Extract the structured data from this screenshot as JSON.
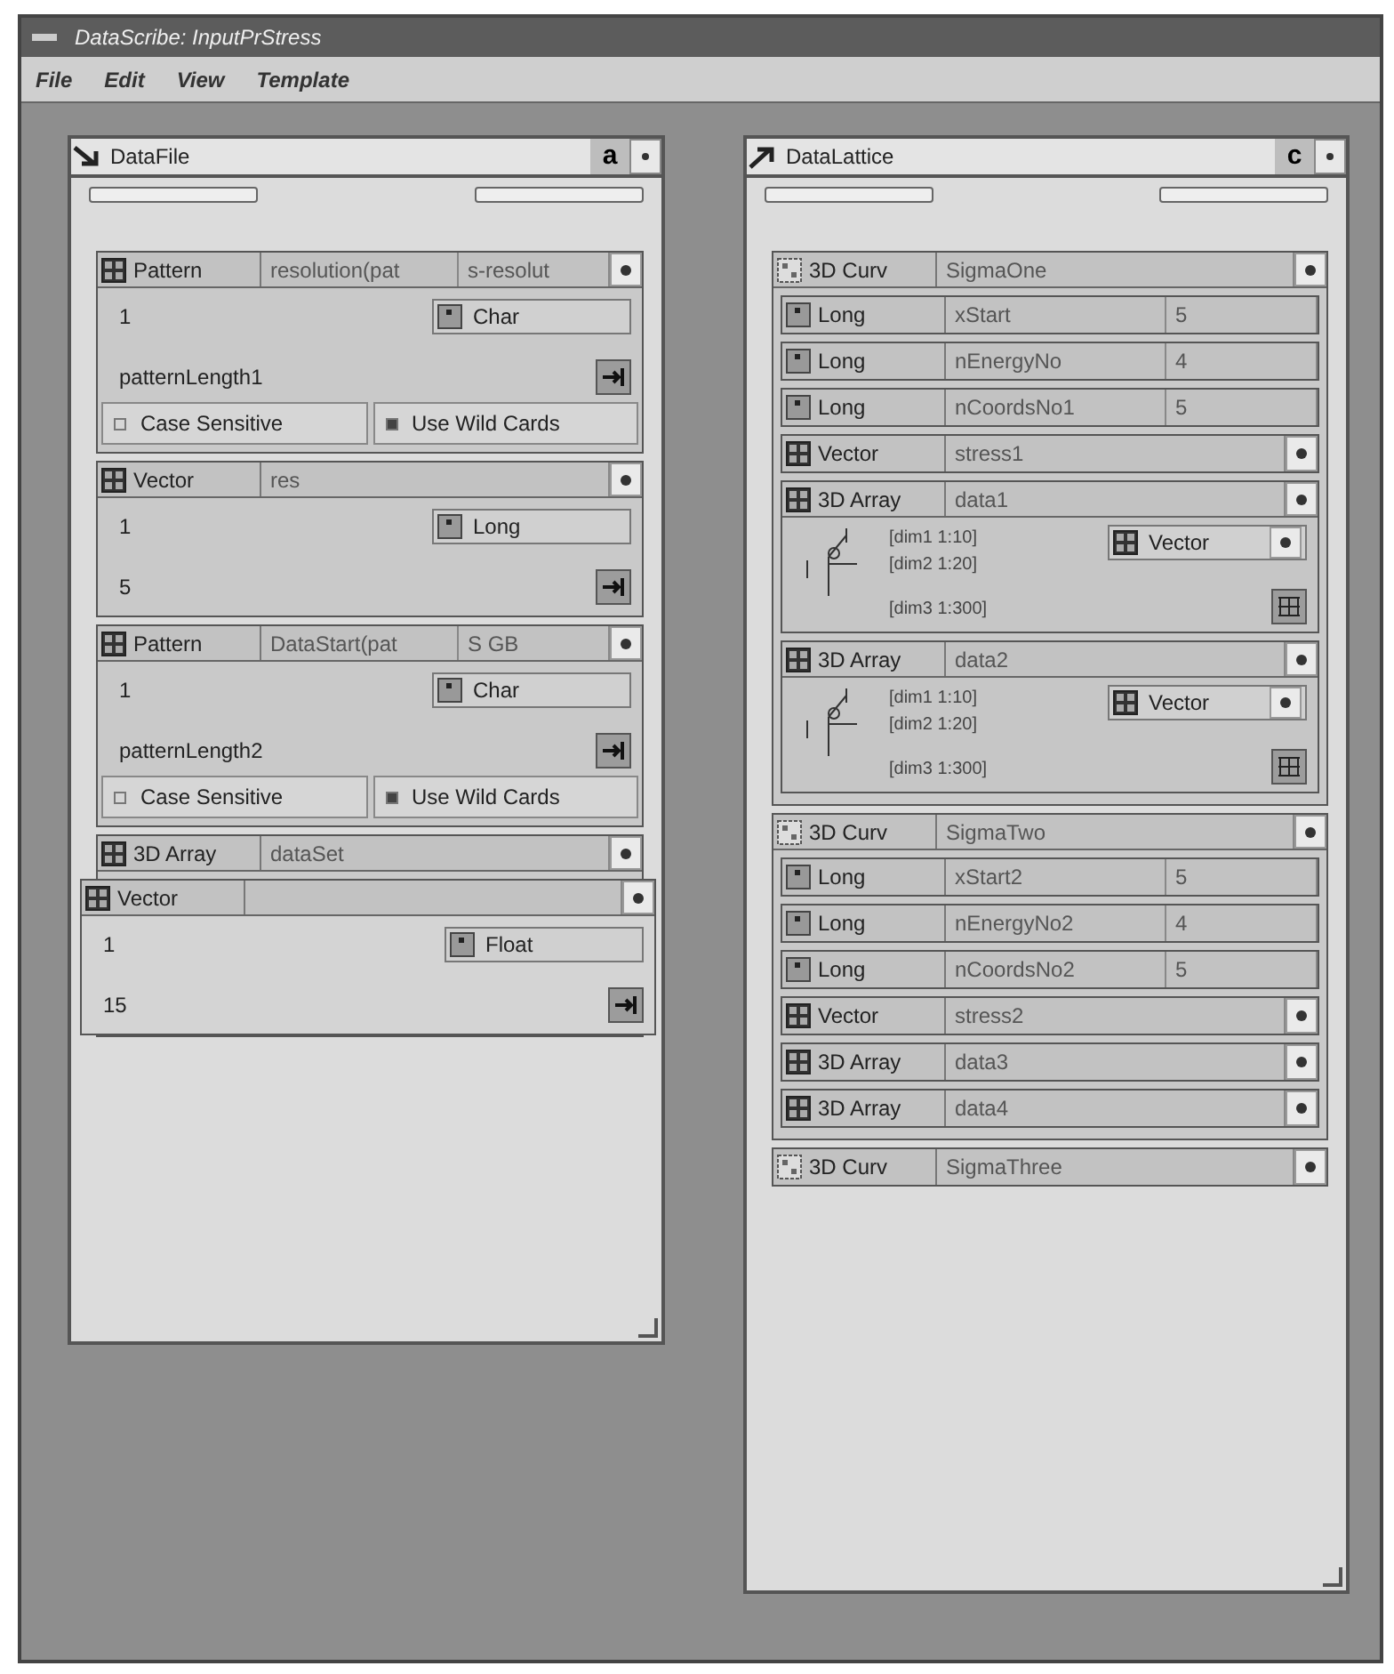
{
  "window": {
    "title": "DataScribe: InputPrStress"
  },
  "menu": [
    "File",
    "Edit",
    "View",
    "Template"
  ],
  "panels": [
    {
      "title": "DataFile",
      "mode": "a",
      "items": [
        {
          "kind": "pattern",
          "type": "Pattern",
          "name": "resolution(pat",
          "value": "s-resolut",
          "index": "1",
          "element_type": "Char",
          "length": "patternLength1",
          "options": [
            {
              "label": "Case Sensitive",
              "checked": false
            },
            {
              "label": "Use Wild Cards",
              "checked": true
            }
          ]
        },
        {
          "kind": "vector",
          "type": "Vector",
          "name": "res",
          "index": "1",
          "element_type": "Long",
          "length": "5"
        },
        {
          "kind": "pattern",
          "type": "Pattern",
          "name": "DataStart(pat",
          "value": "S GB",
          "index": "1",
          "element_type": "Char",
          "length": "patternLength2",
          "options": [
            {
              "label": "Case Sensitive",
              "checked": false
            },
            {
              "label": "Use Wild Cards",
              "checked": true
            }
          ]
        },
        {
          "kind": "array",
          "type": "3D Array",
          "name": "dataSet",
          "children": [
            {
              "kind": "vector",
              "type": "Vector",
              "index": "1",
              "element_type": "Float",
              "length": "15"
            }
          ]
        }
      ]
    },
    {
      "title": "DataLattice",
      "mode": "c",
      "items": [
        {
          "kind": "curve",
          "type": "3D Curv",
          "name": "SigmaOne",
          "expanded": true,
          "children": [
            {
              "kind": "scalar",
              "type": "Long",
              "name": "xStart",
              "value": "5"
            },
            {
              "kind": "scalar",
              "type": "Long",
              "name": "nEnergyNo",
              "value": "4"
            },
            {
              "kind": "scalar",
              "type": "Long",
              "name": "nCoordsNo1",
              "value": "5"
            },
            {
              "kind": "ref",
              "type": "Vector",
              "name": "stress1"
            },
            {
              "kind": "tree",
              "type": "3D Array",
              "name": "data1",
              "element_type": "Vector",
              "dims": [
                "[dim1 1:10]",
                "[dim2 1:20]",
                "[dim3 1:300]"
              ]
            },
            {
              "kind": "tree",
              "type": "3D Array",
              "name": "data2",
              "element_type": "Vector",
              "dims": [
                "[dim1 1:10]",
                "[dim2 1:20]",
                "[dim3 1:300]"
              ]
            }
          ]
        },
        {
          "kind": "curve",
          "type": "3D Curv",
          "name": "SigmaTwo",
          "expanded": true,
          "children": [
            {
              "kind": "scalar",
              "type": "Long",
              "name": "xStart2",
              "value": "5"
            },
            {
              "kind": "scalar",
              "type": "Long",
              "name": "nEnergyNo2",
              "value": "4"
            },
            {
              "kind": "scalar",
              "type": "Long",
              "name": "nCoordsNo2",
              "value": "5"
            },
            {
              "kind": "ref",
              "type": "Vector",
              "name": "stress2"
            },
            {
              "kind": "ref",
              "type": "3D Array",
              "name": "data3"
            },
            {
              "kind": "ref",
              "type": "3D Array",
              "name": "data4"
            }
          ]
        },
        {
          "kind": "curve",
          "type": "3D Curv",
          "name": "SigmaThree",
          "expanded": false
        }
      ]
    }
  ]
}
